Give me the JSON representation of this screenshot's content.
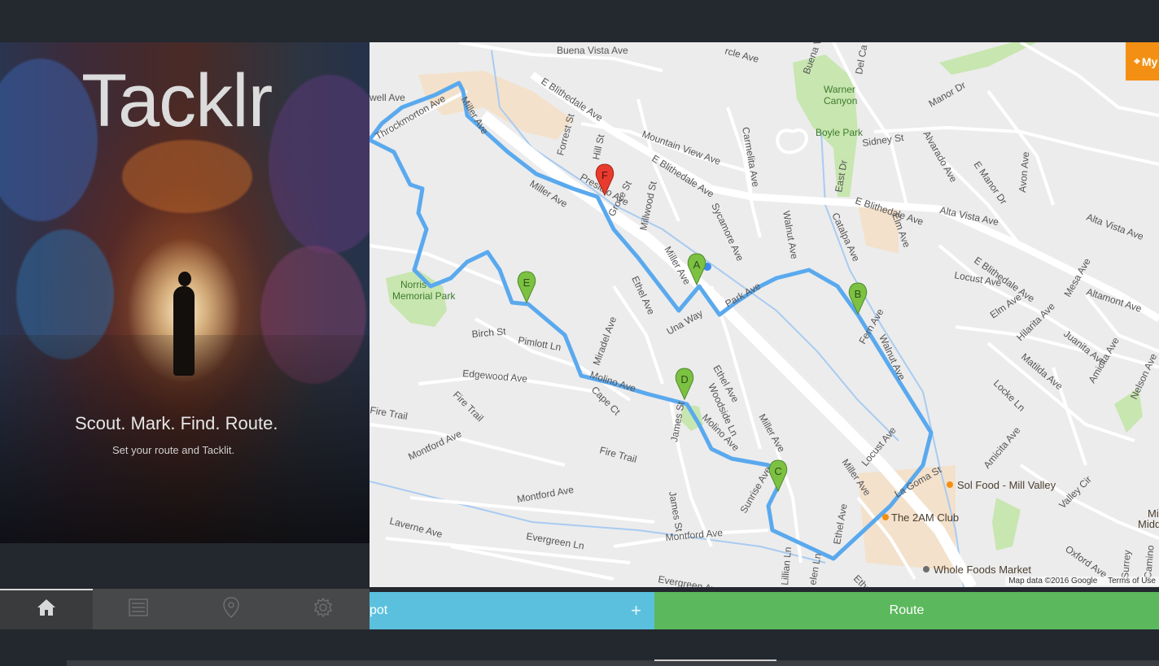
{
  "app": {
    "title": "Tacklr",
    "tagline": "Scout. Mark. Find. Route.",
    "subtagline": "Set your route and Tacklit."
  },
  "tabs": [
    {
      "name": "home",
      "icon": "home-icon",
      "active": true
    },
    {
      "name": "list",
      "icon": "list-icon",
      "active": false
    },
    {
      "name": "location",
      "icon": "map-pin-icon",
      "active": false
    },
    {
      "name": "settings",
      "icon": "gear-icon",
      "active": false
    }
  ],
  "map": {
    "my_location_label": "My",
    "attribution": "Map data ©2016 Google",
    "terms": "Terms of Use",
    "markers": [
      {
        "label": "A",
        "color": "#7cc142"
      },
      {
        "label": "B",
        "color": "#7cc142"
      },
      {
        "label": "C",
        "color": "#7cc142"
      },
      {
        "label": "D",
        "color": "#7cc142"
      },
      {
        "label": "E",
        "color": "#7cc142"
      },
      {
        "label": "F",
        "color": "#e83b2e"
      }
    ],
    "streets": {
      "buena_vista_ave": "Buena Vista Ave",
      "e_blithedale_1": "E Blithedale Ave",
      "throckmorton": "Throckmorton Ave",
      "miller_ave_1": "Miller Ave",
      "well_ave": "well Ave",
      "forrest_st": "Forrest St",
      "hill_st": "Hill St",
      "mountain_view": "Mountain View Ave",
      "e_blithedale_2": "E Blithedale Ave",
      "presidio": "Presidio Ave",
      "grove_st": "Grove St",
      "millwood_st": "Millwood St",
      "miller_ave_2": "Miller Ave",
      "camelita": "Carmelita Ave",
      "sycamore": "Sycamore Ave",
      "walnut_ave": "Walnut Ave",
      "catalpa": "Catalpa Ave",
      "elm_ave": "Elm Ave",
      "e_blithedale_3": "E Blithedale Ave",
      "alta_vista": "Alta Vista Ave",
      "alta_vista_2": "Alta Vista Ave",
      "east_dr": "East Dr",
      "sidney_st": "Sidney St",
      "alvarado": "Alvarado Ave",
      "e_manor_dr": "E Manor Dr",
      "manor_dr": "Manor Dr",
      "avon_ave": "Avon Ave",
      "buena_vista_2": "Buena Vis",
      "del_casa": "Del Ca",
      "circle_ave": "rcle Ave",
      "locust_ave": "Locust Ave",
      "e_blithedale_4": "E Blithedale Ave",
      "mesa_ave": "Mesa Ave",
      "altamont": "Altamont Ave",
      "elm_ave_2": "Elm Ave",
      "hilarita": "Hilarita Ave",
      "juanita": "Juanita Ave",
      "matilda": "Matilda Ave",
      "amicita": "Amicita Ave",
      "nelson": "Nelson Ave",
      "locke_ln": "Locke Ln",
      "amicita_2": "Amicita Ave",
      "fern_ave": "Fern Ave",
      "walnut_ave_2": "Walnut Ave",
      "park_ave": "Park Ave",
      "miller_ave_3": "Miller Ave",
      "una_way": "Una Way",
      "ethel_ave": "Ethel Ave",
      "ethel_ave_2": "Ethel Ave",
      "woodside": "Woodside Ln",
      "molino_ave": "Molino Ave",
      "molino_ave_2": "Molino Ave",
      "birch_st": "Birch St",
      "pimlott": "Pimlott Ln",
      "miradel": "Miradel Ave",
      "edgewood": "Edgewood Ave",
      "fire_trail": "Fire Trail",
      "fire_trail_2": "Fire Trail",
      "fire_trail_3": "Fire Trail",
      "cape_ct": "Cape Ct",
      "james_st": "James St",
      "james_st_2": "James St",
      "montford": "Montford Ave",
      "montford_2": "Montford Ave",
      "montford_3": "Montford Ave",
      "sunrise": "Sunrise Ave",
      "lavaerne": "Laverne Ave",
      "evergreen": "Evergreen Ln",
      "evergreen_2": "Evergreen Ave",
      "miller_ave_4": "Miller Ave",
      "locust_ave_2": "Locust Ave",
      "la_goma": "La Goma St",
      "valley_cir": "Valley Cir",
      "oxford": "Oxford Ave",
      "ethel_ave_3": "Ethel Ave",
      "lillian": "Lillian Ln",
      "helen_ln": "elen Ln",
      "ethel_4": "Ethel",
      "surrey": "Surrey",
      "camino": "Camino"
    },
    "parks": {
      "warner_canyon": "Warner",
      "warner_canyon_2": "Canyon",
      "boyle_park": "Boyle Park",
      "norris": "Norris",
      "norris_2": "Memorial Park"
    },
    "pois": {
      "sol_food": "Sol Food - Mill Valley",
      "two_am": "The 2AM Club",
      "whole_foods": "Whole Foods Market",
      "mill_valley_middle": "Mill",
      "mill_valley_middle_2": "Middle"
    }
  },
  "actions": {
    "spot_label": "pot",
    "spot_add": "+",
    "route_label": "Route"
  },
  "colors": {
    "route_line": "#5aa9ee",
    "spot_button": "#5bc0de",
    "route_button": "#5cb85c",
    "my_button": "#f39014"
  }
}
